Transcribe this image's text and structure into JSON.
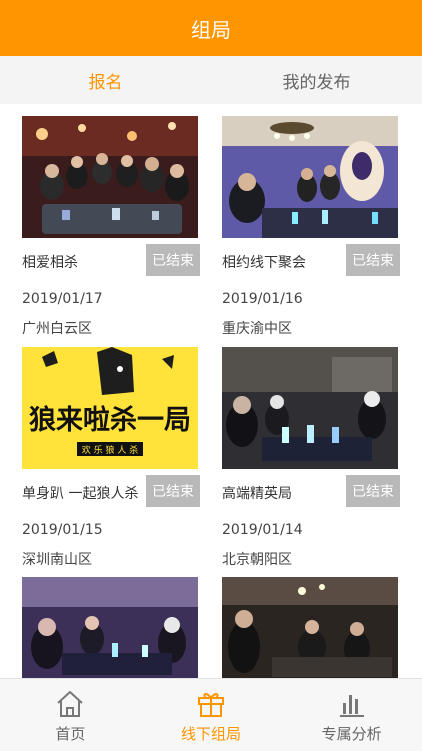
{
  "header": {
    "title": "组局"
  },
  "tabs": [
    {
      "label": "报名",
      "active": true
    },
    {
      "label": "我的发布",
      "active": false
    }
  ],
  "cards": [
    {
      "name": "相爱相杀",
      "status": "已结束",
      "date": "2019/01/17",
      "location": "广州白云区"
    },
    {
      "name": "相约线下聚会",
      "status": "已结束",
      "date": "2019/01/16",
      "location": "重庆渝中区"
    },
    {
      "name": "单身趴 一起狼人杀",
      "status": "已结束",
      "date": "2019/01/15",
      "location": "深圳南山区",
      "poster_text": "狼来啦杀一局",
      "poster_subtext": "欢 乐 狼 人 杀"
    },
    {
      "name": "高端精英局",
      "status": "已结束",
      "date": "2019/01/14",
      "location": "北京朝阳区"
    },
    {
      "name": "",
      "status": "",
      "date": "",
      "location": ""
    },
    {
      "name": "",
      "status": "",
      "date": "",
      "location": ""
    }
  ],
  "bottom_nav": [
    {
      "label": "首页",
      "icon": "home-icon",
      "active": false
    },
    {
      "label": "线下组局",
      "icon": "gift-icon",
      "active": true
    },
    {
      "label": "专属分析",
      "icon": "bar-chart-icon",
      "active": false
    }
  ],
  "colors": {
    "accent": "#ff9500",
    "badge": "#b9b9b9"
  }
}
